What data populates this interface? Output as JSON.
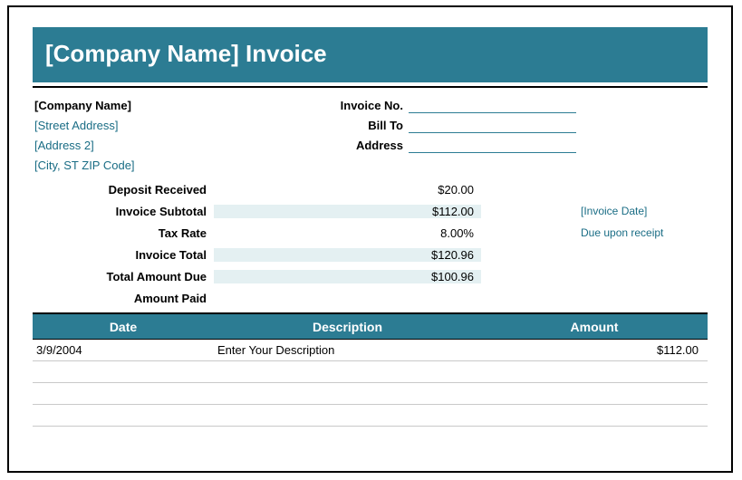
{
  "title": "[Company Name] Invoice",
  "company": {
    "name": "[Company Name]",
    "street": "[Street Address]",
    "address2": "[Address 2]",
    "city_st_zip": "[City, ST  ZIP Code]"
  },
  "header_fields": {
    "invoice_no_label": "Invoice No.",
    "bill_to_label": "Bill To",
    "address_label": "Address"
  },
  "summary": {
    "deposit_received_label": "Deposit Received",
    "deposit_received_value": "$20.00",
    "invoice_subtotal_label": "Invoice Subtotal",
    "invoice_subtotal_value": "$112.00",
    "tax_rate_label": "Tax Rate",
    "tax_rate_value": "8.00%",
    "invoice_total_label": "Invoice Total",
    "invoice_total_value": "$120.96",
    "total_amount_due_label": "Total Amount Due",
    "total_amount_due_value": "$100.96",
    "amount_paid_label": "Amount Paid"
  },
  "side": {
    "invoice_date": "[Invoice Date]",
    "due_text": "Due upon receipt"
  },
  "table": {
    "headers": {
      "date": "Date",
      "description": "Description",
      "amount": "Amount"
    },
    "rows": [
      {
        "date": "3/9/2004",
        "description": "Enter Your Description",
        "amount": "$112.00"
      }
    ]
  }
}
